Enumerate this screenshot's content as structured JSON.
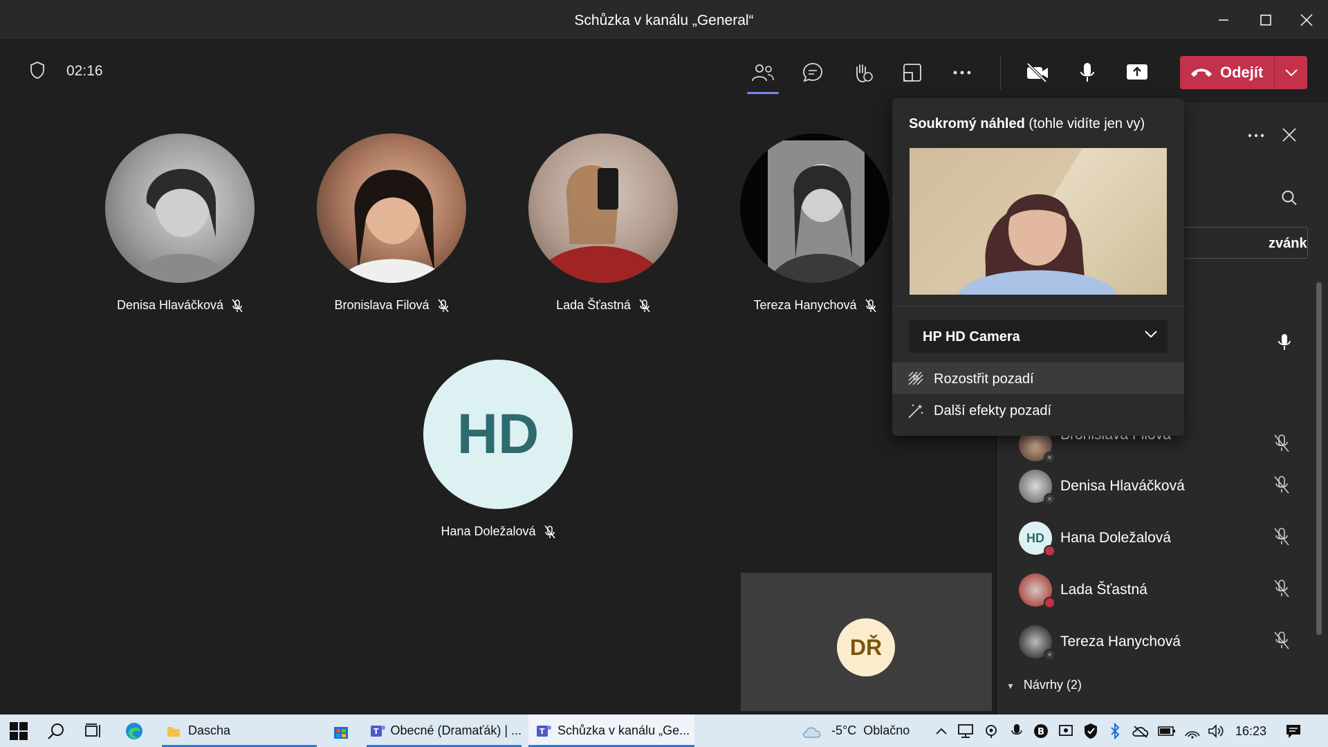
{
  "window": {
    "title": "Schůzka v kanálu „General“"
  },
  "toolbar": {
    "timer": "02:16",
    "leave_label": "Odejít"
  },
  "participants_tiles": [
    {
      "name": "Denisa Hlaváčková"
    },
    {
      "name": "Bronislava Filová"
    },
    {
      "name": "Lada Šťastná"
    },
    {
      "name": "Tereza Hanychová"
    },
    {
      "name": "Hana Doležalová",
      "initials": "HD"
    }
  ],
  "self_tile": {
    "initials": "DŘ"
  },
  "panel": {
    "invite_label": "zvánku",
    "rows": [
      {
        "name": "Bronislava Filová",
        "status": "away"
      },
      {
        "name": "Denisa Hlaváčková",
        "status": "away"
      },
      {
        "name": "Hana Doležalová",
        "initials": "HD",
        "status": "busy"
      },
      {
        "name": "Lada Šťastná",
        "status": "busy"
      },
      {
        "name": "Tereza Hanychová",
        "status": "away"
      }
    ],
    "section_label": "Návrhy (2)"
  },
  "popover": {
    "title_bold": "Soukromý náhled",
    "title_rest": " (tohle vidíte jen vy)",
    "camera": "HP HD Camera",
    "items": [
      {
        "label": "Rozostřit pozadí",
        "icon": "blur-background-icon",
        "active": true
      },
      {
        "label": "Další efekty pozadí",
        "icon": "magic-wand-icon",
        "active": false
      }
    ]
  },
  "taskbar": {
    "items": [
      {
        "label": "Dascha"
      },
      {
        "label": "Obecné (Dramaťák) | ..."
      },
      {
        "label": "Schůzka v kanálu „Ge..."
      }
    ],
    "weather_temp": "-5°C",
    "weather_text": "Oblačno",
    "clock": "16:23"
  },
  "colors": {
    "accent": "#7f85f5",
    "leave": "#c4314b",
    "hd_avatar_bg": "#ddf1f3",
    "dr_avatar_bg": "#fbeccd",
    "busy": "#c4314b"
  }
}
